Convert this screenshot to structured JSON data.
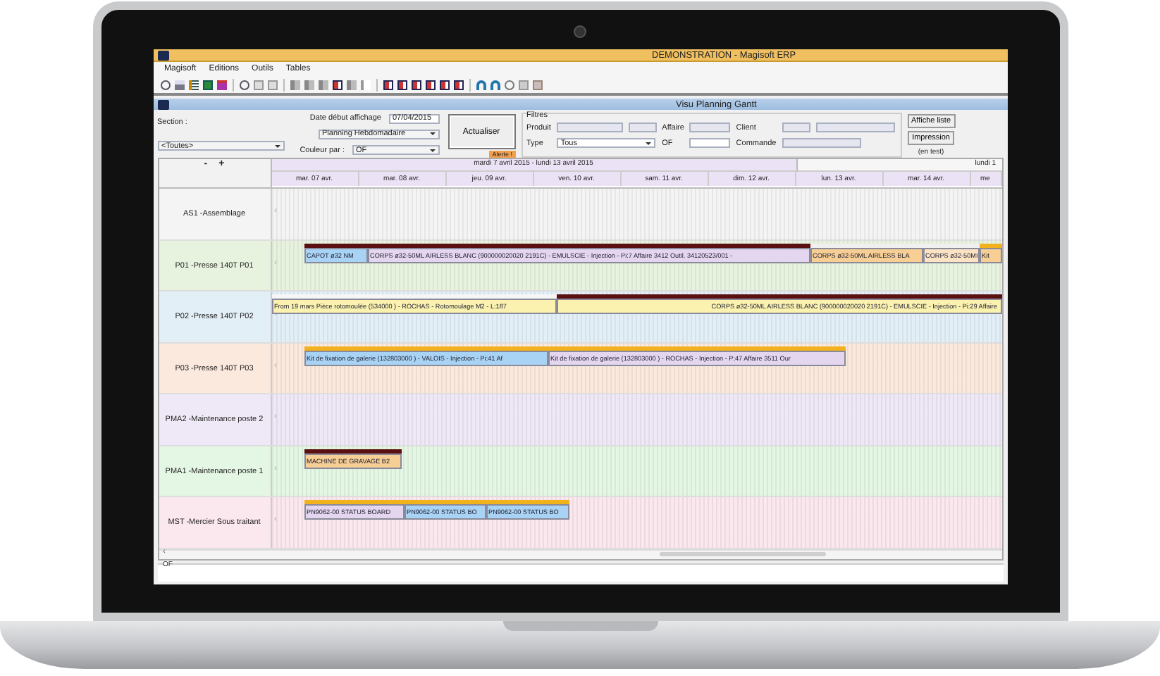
{
  "window": {
    "title": "DEMONSTRATION - Magisoft ERP"
  },
  "menu": [
    "Magisoft",
    "Editions",
    "Outils",
    "Tables"
  ],
  "subwindow": {
    "title": "Visu Planning Gantt"
  },
  "form": {
    "section_label": "Section :",
    "section_value": "<Toutes>",
    "date_label": "Date début affichage",
    "date_value": "07/04/2015",
    "view_value": "Planning Hebdomadaire",
    "color_label": "Couleur par :",
    "color_value": "OF",
    "refresh_button": "Actualiser",
    "alert_badge": "Alerte !",
    "filters": {
      "title": "Filtres",
      "product_label": "Produit",
      "affaire_label": "Affaire",
      "client_label": "Client",
      "type_label": "Type",
      "type_value": "Tous",
      "of_label": "OF",
      "commande_label": "Commande"
    },
    "list_button": "Affiche liste",
    "print_button": "Impression",
    "print_note": "(en test)"
  },
  "gantt": {
    "zoom_out": "-",
    "zoom_in": "+",
    "periods": [
      "mardi 7 avril 2015 - lundi 13 avril 2015",
      "lundi 1"
    ],
    "days": [
      "mar. 07 avr.",
      "mar. 08 avr.",
      "jeu. 09 avr.",
      "ven. 10 avr.",
      "sam. 11 avr.",
      "dim. 12 avr.",
      "lun. 13 avr.",
      "mar. 14 avr.",
      "me"
    ],
    "rows": [
      {
        "label": "AS1  -Assemblage",
        "handle": "‹",
        "color": "#f4f4f4",
        "bars": []
      },
      {
        "label": "P01  -Presse 140T P01",
        "handle": "‹",
        "color": "#e8f3df",
        "bars": [
          {
            "text": "CAPOT ø32 NM",
            "color": "#a9d3f5",
            "marker": {
              "color": "#5a1010"
            }
          },
          {
            "text": "CORPS ø32-50ML AIRLESS BLANC  (900000020020 2191C) - EMULSCIE - Injection - Pi:7  Affaire 3412 Outil. 34120523/001 -",
            "color": "#e4d6ef",
            "marker": {
              "color": "#5a1010"
            }
          },
          {
            "text": "CORPS ø32-50ML AIRLESS BLA",
            "color": "#f7cf95",
            "marker": {
              "color": "#f0f0f0"
            }
          },
          {
            "text": "CORPS ø32-50MI",
            "color": "#fbe3c4",
            "marker": {
              "color": "#f0f0f0"
            }
          },
          {
            "text": "Kit",
            "color": "#f7cf95",
            "marker": {
              "color": "#f2b21e"
            }
          }
        ]
      },
      {
        "label": "P02  -Presse 140T P02",
        "handle": "‹",
        "color": "#e3eff7",
        "bars": [
          {
            "text": "From 19 mars Pièce rotomoulée  (534000 ) - ROCHAS - Rotomoulage M2 - L:187",
            "color": "#fbf2b0",
            "marker": {
              "color": "#f6f6f6"
            }
          },
          {
            "text": "CORPS ø32-50ML AIRLESS BLANC  (900000020020 2191C) - EMULSCIE - Injection - Pi:29  Affaire",
            "color": "#fbf2b0",
            "marker": {
              "color": "#5a1010"
            }
          }
        ]
      },
      {
        "label": "P03  -Presse 140T P03",
        "handle": "‹",
        "color": "#fbe9dd",
        "bars": [
          {
            "text": "Kit de fixation de galerie  (132803000 ) - VALOIS - Injection - Pi:41  Af",
            "color": "#a9d3f5",
            "marker": {
              "color": "#f2b21e"
            }
          },
          {
            "text": "Kit de fixation de galerie  (132803000 ) - ROCHAS - Injection - P:47  Affaire 3511 Our",
            "color": "#e4d6ef",
            "marker": {
              "color": "#f2b21e"
            }
          }
        ]
      },
      {
        "label": "PMA2  -Maintenance poste 2",
        "handle": "‹",
        "color": "#efe9f7",
        "bars": []
      },
      {
        "label": "PMA1  -Maintenance poste 1",
        "handle": "‹",
        "color": "#e4f6e4",
        "bars": [
          {
            "text": "MACHINE DE GRAVAGE B2",
            "color": "#f7cf95",
            "marker": {
              "color": "#5a1010"
            }
          }
        ]
      },
      {
        "label": "MST  -Mercier Sous traitant",
        "handle": "‹",
        "color": "#fbe7ee",
        "bars": [
          {
            "text": "PN9062-00 STATUS BOARD",
            "color": "#e4d6ef",
            "marker": {
              "color": "#f2b21e"
            }
          },
          {
            "text": "PN9062-00 STATUS BO",
            "color": "#a9d3f5",
            "marker": {
              "color": "#f2b21e"
            }
          },
          {
            "text": "PN9062-00 STATUS BO",
            "color": "#a9d3f5",
            "marker": {
              "color": "#f2b21e"
            }
          }
        ]
      }
    ],
    "scroll_left": "‹"
  },
  "bottom": {
    "of_label": "OF"
  }
}
